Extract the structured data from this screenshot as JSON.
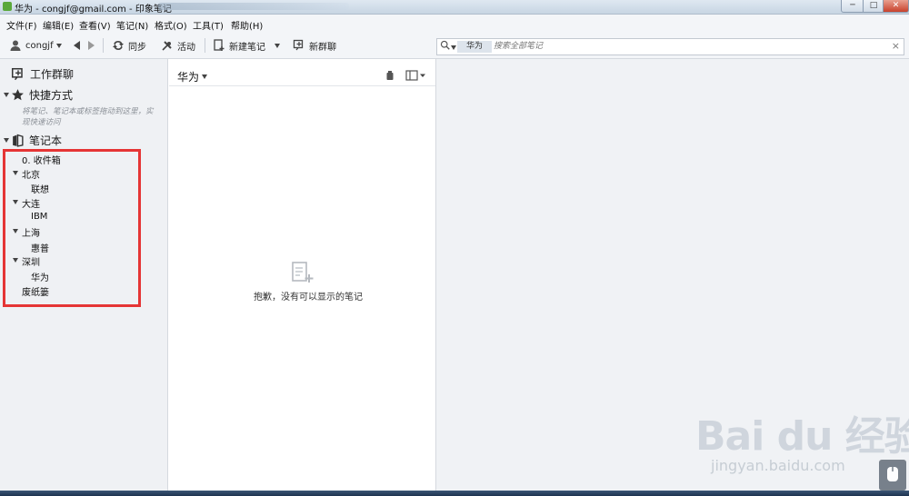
{
  "window": {
    "title": "华为 - congjf@gmail.com - 印象笔记",
    "min": "─",
    "max": "□",
    "close": "✕"
  },
  "menu": [
    "文件(F)",
    "编辑(E)",
    "查看(V)",
    "笔记(N)",
    "格式(O)",
    "工具(T)",
    "帮助(H)"
  ],
  "toolbar": {
    "user": "congjf",
    "sync": "同步",
    "activity": "活动",
    "new_note": "新建笔记",
    "new_chat": "新群聊"
  },
  "search": {
    "scope": "华为",
    "placeholder": "搜索全部笔记",
    "clear": "×"
  },
  "sidebar": {
    "work_chat": "工作群聊",
    "shortcuts": "快捷方式",
    "shortcuts_hint_1": "将笔记、笔记本或标签拖动到这里，实",
    "shortcuts_hint_2": "现快速访问",
    "notebooks": "笔记本",
    "items": [
      {
        "label": "0. 收件箱"
      },
      {
        "label": "北京"
      },
      {
        "label": "联想"
      },
      {
        "label": "大连"
      },
      {
        "label": "IBM"
      },
      {
        "label": "上海"
      },
      {
        "label": "惠普"
      },
      {
        "label": "深圳"
      },
      {
        "label": "华为"
      },
      {
        "label": "废纸篓"
      }
    ]
  },
  "notelist": {
    "title": "华为",
    "empty": "抱歉，没有可以显示的笔记"
  },
  "watermark": {
    "logo": "Bai du 经验",
    "url": "jingyan.baidu.com"
  }
}
